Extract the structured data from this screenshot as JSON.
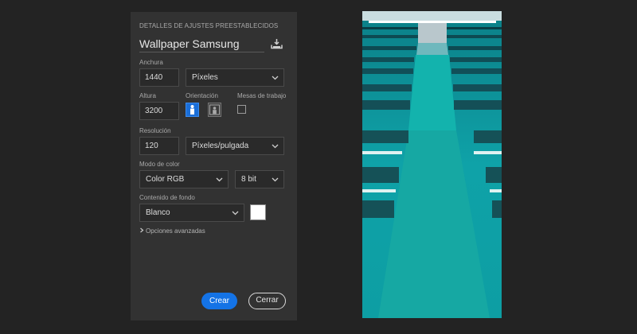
{
  "dialog": {
    "section_title": "DETALLES DE AJUSTES PREESTABLECIDOS",
    "preset_name": "Wallpaper Samsung",
    "width": {
      "label": "Anchura",
      "value": "1440",
      "unit": "Píxeles"
    },
    "height": {
      "label": "Altura",
      "value": "3200"
    },
    "orientation": {
      "label": "Orientación",
      "selected": "portrait"
    },
    "artboards": {
      "label": "Mesas de trabajo",
      "checked": false
    },
    "resolution": {
      "label": "Resolución",
      "value": "120",
      "unit": "Píxeles/pulgada"
    },
    "color_mode": {
      "label": "Modo de color",
      "mode": "Color RGB",
      "depth": "8 bit"
    },
    "background": {
      "label": "Contenido de fondo",
      "value": "Blanco",
      "swatch_color": "#ffffff"
    },
    "advanced": "Opciones avanzadas",
    "create_label": "Crear",
    "close_label": "Cerrar"
  },
  "colors": {
    "accent": "#1473e6",
    "panel": "#323232",
    "page": "#232323",
    "preview_teal": "#0e9aa1"
  },
  "icons": [
    "save-preset-icon",
    "chevron-down-icon",
    "portrait-icon",
    "landscape-icon",
    "chevron-right-icon"
  ]
}
